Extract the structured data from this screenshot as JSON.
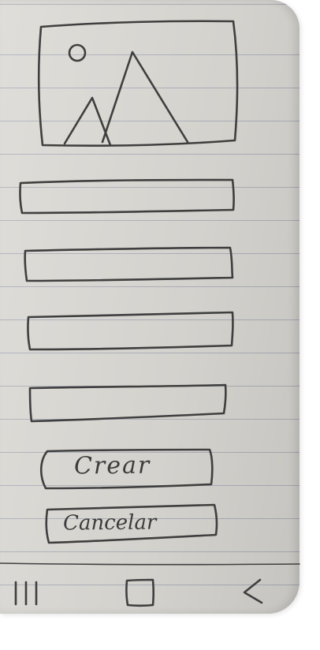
{
  "form": {
    "image_placeholder_icon": "image-placeholder-icon",
    "fields": [
      {
        "name": "input-field-1"
      },
      {
        "name": "input-field-2"
      },
      {
        "name": "input-field-3"
      },
      {
        "name": "input-field-4"
      }
    ],
    "create_label": "Crear",
    "cancel_label": "Cancelar"
  },
  "nav_bar": {
    "recents_icon": "recents-icon",
    "home_icon": "home-icon",
    "back_icon": "back-icon"
  },
  "colors": {
    "paper": "#dcdad5",
    "pencil": "#3f3f3f",
    "ruled_line": "#7882a0"
  }
}
